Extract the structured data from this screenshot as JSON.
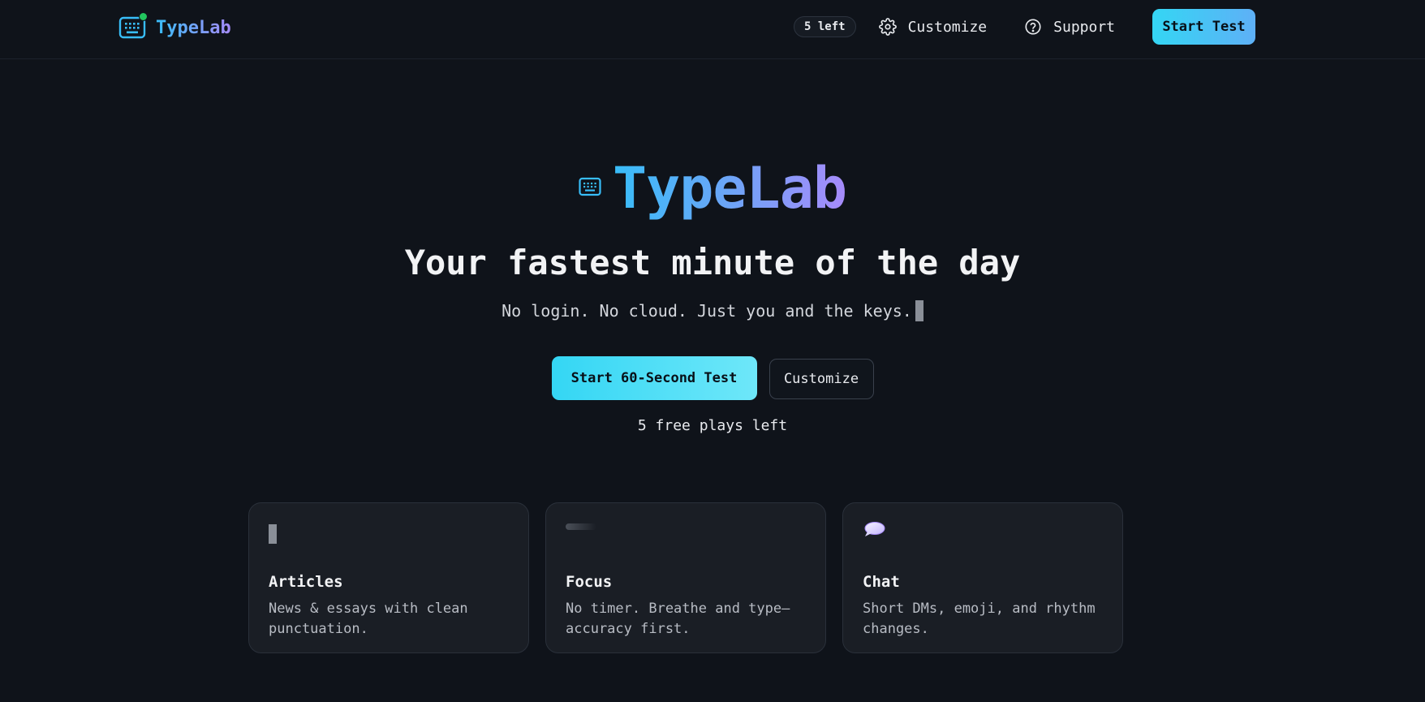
{
  "brand": {
    "name": "TypeLab",
    "logo_icon": "keyboard-icon",
    "status_color": "#22c55e"
  },
  "nav": {
    "plays_pill": "5 left",
    "customize_label": "Customize",
    "customize_icon": "gear-icon",
    "support_label": "Support",
    "support_icon": "help-circle-icon",
    "start_label": "Start Test"
  },
  "hero": {
    "logo_text": "TypeLab",
    "heading": "Your fastest minute of the day",
    "subheading": "No login. No cloud. Just you and the keys.",
    "primary_button": "Start 60-Second Test",
    "secondary_button": "Customize",
    "plays_left": "5 free plays left"
  },
  "cards": [
    {
      "icon": "text-caret-icon",
      "title": "Articles",
      "description": "News & essays with clean punctuation."
    },
    {
      "icon": "focus-bar-icon",
      "title": "Focus",
      "description": "No timer. Breathe and type—accuracy first."
    },
    {
      "icon": "speech-bubble-icon",
      "title": "Chat",
      "description": "Short DMs, emoji, and rhythm changes."
    }
  ],
  "colors": {
    "background": "#0f131a",
    "accent_cyan": "#34d6f4",
    "accent_blue": "#38bdf8",
    "accent_violet": "#a78bfa",
    "card_background": "#1a1e25"
  }
}
